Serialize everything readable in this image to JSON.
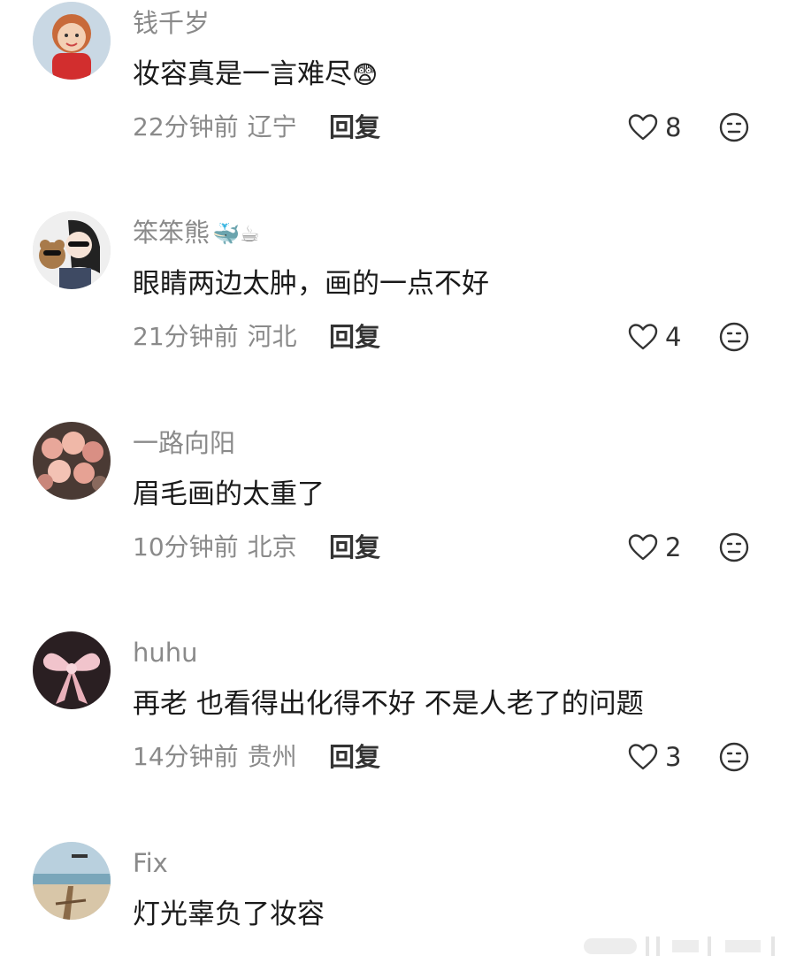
{
  "reply_label": "回复",
  "comments": [
    {
      "username": "钱千岁",
      "username_emoji": "",
      "text": "妆容真是一言难尽",
      "text_emoji": "😨",
      "time": "22分钟前",
      "location": "辽宁",
      "likes": "8",
      "avatar_icon": "girl-red-dress-avatar"
    },
    {
      "username": "笨笨熊",
      "username_emoji": "🐳☕",
      "text": "眼睛两边太肿，画的一点不好",
      "text_emoji": "",
      "time": "21分钟前",
      "location": "河北",
      "likes": "4",
      "avatar_icon": "girl-with-bear-avatar"
    },
    {
      "username": "一路向阳",
      "username_emoji": "",
      "text": "眉毛画的太重了",
      "text_emoji": "",
      "time": "10分钟前",
      "location": "北京",
      "likes": "2",
      "avatar_icon": "flowers-avatar"
    },
    {
      "username": "huhu",
      "username_emoji": "",
      "text": "再老 也看得出化得不好 不是人老了的问题",
      "text_emoji": "",
      "time": "14分钟前",
      "location": "贵州",
      "likes": "3",
      "avatar_icon": "pink-bow-avatar"
    },
    {
      "username": "Fix",
      "username_emoji": "",
      "text": "灯光辜负了妆容",
      "text_emoji": "",
      "time": "",
      "location": "",
      "likes": "",
      "avatar_icon": "beach-avatar"
    }
  ]
}
